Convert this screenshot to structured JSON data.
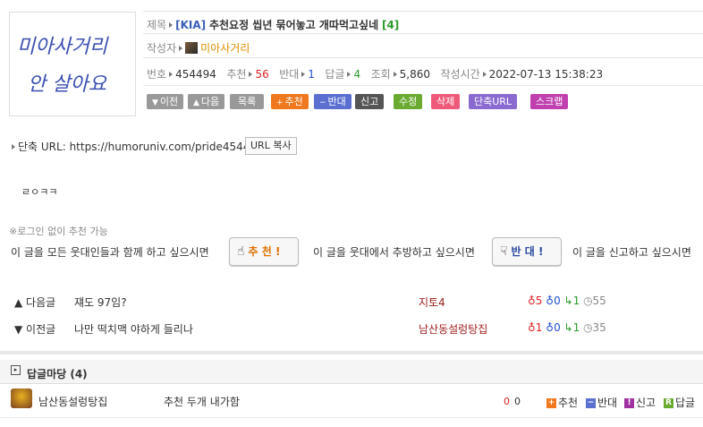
{
  "avatar_text": {
    "line1": "미아사거리",
    "line2": "안 살아요"
  },
  "meta": {
    "title_label": "제목",
    "category": "[KIA]",
    "title": "추천요정 씹년 묶어놓고 개따먹고싶네",
    "comment_count": "[4]",
    "author_label": "작성자",
    "author": "미아사거리",
    "no_label": "번호",
    "no": "454494",
    "rec_label": "추천",
    "rec": "56",
    "opp_label": "반대",
    "opp": "1",
    "reply_label": "답글",
    "reply": "4",
    "view_label": "조회",
    "view": "5,860",
    "time_label": "작성시간",
    "time": "2022-07-13 15:38:23"
  },
  "buttons": {
    "prev": "이전",
    "next": "다음",
    "list": "목록",
    "recommend": "추천",
    "oppose": "반대",
    "report": "신고",
    "edit": "수정",
    "delete": "삭제",
    "shorturl": "단축URL",
    "scrap": "스크랩"
  },
  "colors": {
    "prev": "#999999",
    "next": "#999999",
    "list": "#999999",
    "recommend": "#f0781e",
    "oppose": "#5a6fd0",
    "report": "#555555",
    "edit": "#6aaa30",
    "delete": "#f05a7a",
    "shorturl": "#8a6ad0",
    "scrap": "#c040b0"
  },
  "short_url": {
    "label": "단축 URL:",
    "url": "https://humoruniv.com/pride454494",
    "copy_button": "URL 복사"
  },
  "body_text": "ㄹㅇㅋㅋ",
  "vote": {
    "notice": "로그인 없이 추천 가능",
    "rec_prompt": "이 글을 모든 웃대인들과 함께 하고 싶으시면",
    "rec_button": "추 천 !",
    "opp_prompt": "이 글을 웃대에서 추방하고 싶으시면",
    "opp_button": "반 대 !",
    "report_prompt": "이 글을 신고하고 싶으시면"
  },
  "nav": [
    {
      "dir": "▲ 다음글",
      "title": "쟤도 97임?",
      "author": "지토4",
      "up": "5",
      "down": "0",
      "reply": "1",
      "view": "55"
    },
    {
      "dir": "▼ 이전글",
      "title": "나만 떡치맥 야하게 들리나",
      "author": "남산동설렁탕집",
      "up": "1",
      "down": "0",
      "reply": "1",
      "view": "35"
    }
  ],
  "comments": {
    "header": "답글마당 (4)",
    "items": [
      {
        "author": "남산동설렁탕집",
        "text": "추천 두개 내가함",
        "up": "0",
        "down": "0",
        "actions": {
          "recommend": "추천",
          "oppose": "반대",
          "report": "신고",
          "reply": "답글"
        }
      }
    ]
  }
}
